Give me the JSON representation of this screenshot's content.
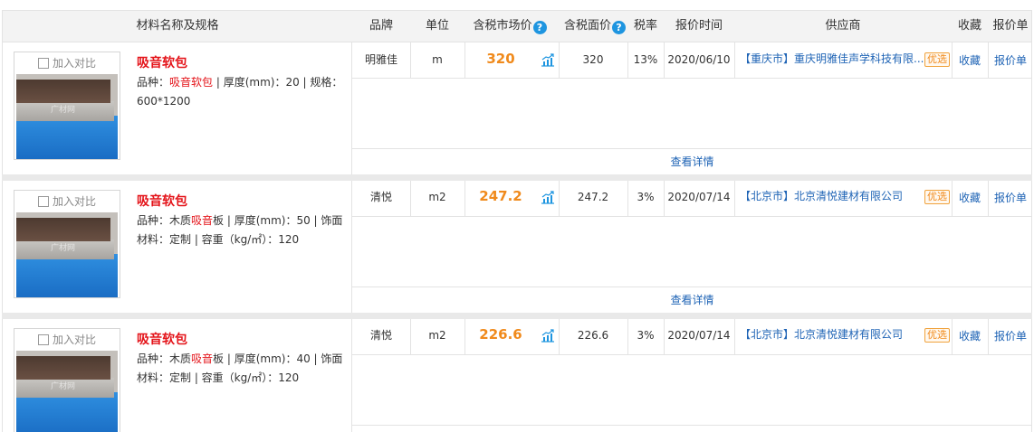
{
  "header": {
    "name_spec": "材料名称及规格",
    "brand": "品牌",
    "unit": "单位",
    "market_price": "含税市场价",
    "face_price": "含税面价",
    "tax_rate": "税率",
    "quote_time": "报价时间",
    "supplier": "供应商",
    "favorite": "收藏",
    "quote_sheet": "报价单",
    "help_icon_char": "?"
  },
  "common": {
    "compare_label": "加入对比",
    "detail_link": "查看详情",
    "badge_label": "优选",
    "favorite_link": "收藏",
    "quote_link": "报价单",
    "watermark": "广材网"
  },
  "rows": [
    {
      "name": "吸音软包",
      "spec_prefix": "品种：",
      "spec_highlight": "吸音软包",
      "spec_rest": " | 厚度(mm)：20 | 规格：600*1200",
      "brand": "明雅佳",
      "unit": "m",
      "market_price": "320",
      "face_price": "320",
      "tax_rate": "13%",
      "quote_time": "2020/06/10",
      "supplier": "【重庆市】重庆明雅佳声学科技有限..."
    },
    {
      "name": "吸音软包",
      "spec_prefix": "品种：木质",
      "spec_highlight": "吸音",
      "spec_rest": "板 | 厚度(mm)：50 | 饰面材料：定制 | 容重（kg/㎡）：120",
      "brand": "清悦",
      "unit": "m2",
      "market_price": "247.2",
      "face_price": "247.2",
      "tax_rate": "3%",
      "quote_time": "2020/07/14",
      "supplier": "【北京市】北京清悦建材有限公司"
    },
    {
      "name": "吸音软包",
      "spec_prefix": "品种：木质",
      "spec_highlight": "吸音",
      "spec_rest": "板 | 厚度(mm)：40 | 饰面材料：定制 | 容重（kg/㎡）：120",
      "brand": "清悦",
      "unit": "m2",
      "market_price": "226.6",
      "face_price": "226.6",
      "tax_rate": "3%",
      "quote_time": "2020/07/14",
      "supplier": "【北京市】北京清悦建材有限公司"
    }
  ],
  "colors": {
    "price": "#f08a1c",
    "name": "#e4141a",
    "link": "#1e63b5",
    "help_icon": "#1e95e0"
  },
  "icons": {
    "help": "question-circle-icon",
    "trend": "price-trend-chart-icon",
    "checkbox": "checkbox-icon"
  }
}
